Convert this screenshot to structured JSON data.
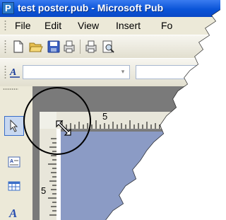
{
  "window": {
    "title": "test poster.pub - Microsoft Pub",
    "app_icon_glyph": "P"
  },
  "menubar": {
    "items": [
      {
        "label": "File"
      },
      {
        "label": "Edit"
      },
      {
        "label": "View"
      },
      {
        "label": "Insert"
      },
      {
        "label": "Fo"
      }
    ]
  },
  "toolbar": {
    "buttons": [
      "new-document-icon",
      "open-folder-icon",
      "save-icon",
      "print-icon",
      "print-icon",
      "print-preview-icon"
    ]
  },
  "formatting_toolbar": {
    "style_icon": "style-icon",
    "dropdown_arrow": "▾"
  },
  "objects_toolbar": {
    "buttons": [
      "select-arrow-icon",
      "text-box-icon",
      "table-icon",
      "wordart-icon"
    ]
  },
  "rulers": {
    "horizontal_label": "5",
    "vertical_label": "5"
  },
  "colors": {
    "titlebar": "#0a54d8",
    "chrome": "#ece9d8",
    "page": "#8b9bc5"
  }
}
